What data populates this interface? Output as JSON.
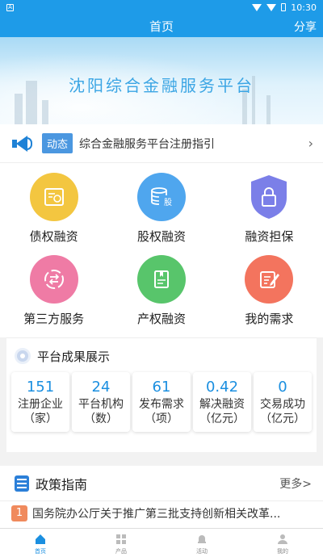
{
  "status_bar": {
    "time": "10:30",
    "left_icon": "a-box-icon"
  },
  "nav": {
    "title": "首页",
    "share_label": "分享"
  },
  "banner": {
    "title": "沈阳综合金融服务平台"
  },
  "ticker": {
    "tag": "动态",
    "text": "综合金融服务平台注册指引"
  },
  "services": [
    {
      "label": "债权融资",
      "icon": "debt-icon",
      "color": "#f3c640"
    },
    {
      "label": "股权融资",
      "icon": "equity-icon",
      "color": "#4fa6ee",
      "glyph": "股"
    },
    {
      "label": "融资担保",
      "icon": "guarantee-icon",
      "color": "#7b7fe8"
    },
    {
      "label": "第三方服务",
      "icon": "third-party-icon",
      "color": "#ef7ba5"
    },
    {
      "label": "产权融资",
      "icon": "property-icon",
      "color": "#58c56b"
    },
    {
      "label": "我的需求",
      "icon": "demand-icon",
      "color": "#f3745e"
    }
  ],
  "achievements": {
    "title": "平台成果展示",
    "stats": [
      {
        "value": "151",
        "label": "注册企业",
        "unit": "（家）"
      },
      {
        "value": "24",
        "label": "平台机构",
        "unit": "（数）"
      },
      {
        "value": "61",
        "label": "发布需求",
        "unit": "（项）"
      },
      {
        "value": "0.42",
        "label": "解决融资",
        "unit": "（亿元）"
      },
      {
        "value": "0",
        "label": "交易成功",
        "unit": "（亿元）"
      }
    ]
  },
  "policy": {
    "title": "政策指南",
    "more": "更多>",
    "items": [
      {
        "index": "1",
        "text": "国务院办公厅关于推广第三批支持创新相关改革..."
      }
    ]
  },
  "tabs": [
    {
      "label": "首页",
      "active": true
    },
    {
      "label": "产品",
      "active": false
    },
    {
      "label": "活动",
      "active": false
    },
    {
      "label": "我的",
      "active": false
    }
  ]
}
